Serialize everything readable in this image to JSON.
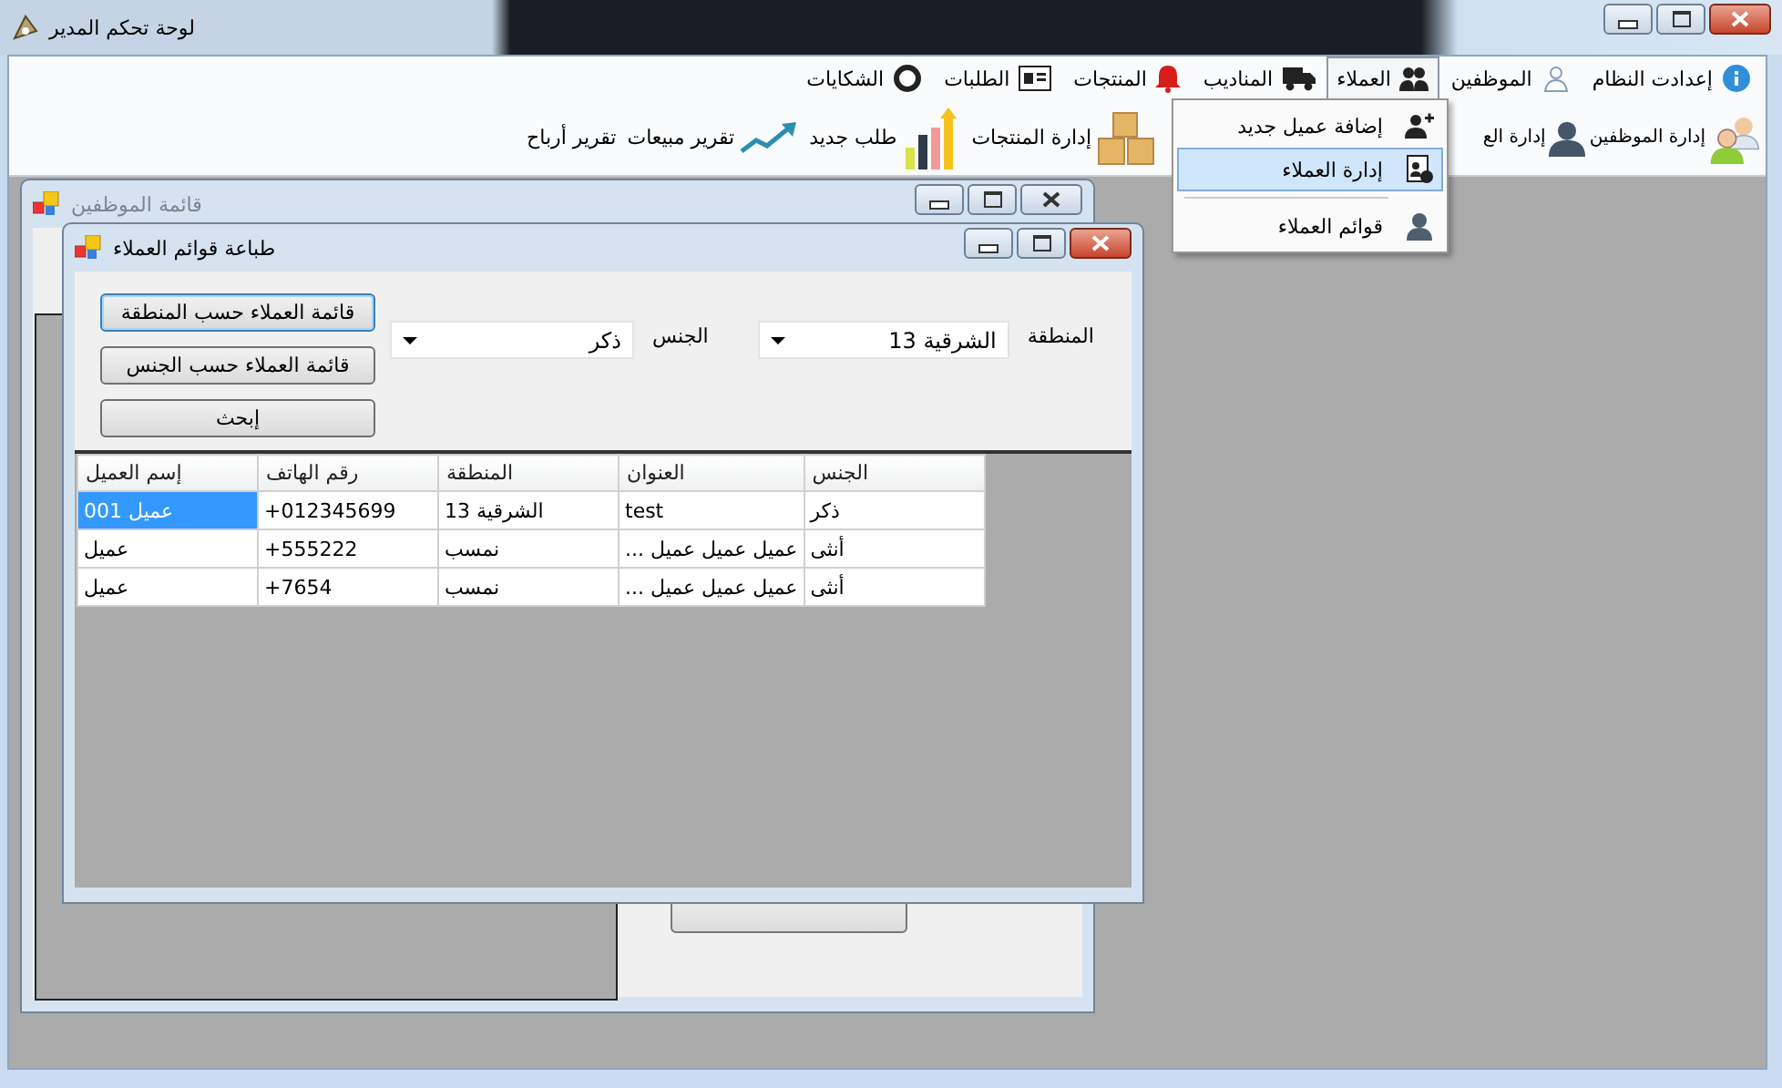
{
  "window": {
    "title": "لوحة تحكم المدير"
  },
  "menu": [
    {
      "label": "إعدادت النظام",
      "selected": false
    },
    {
      "label": "الموظفين",
      "selected": false
    },
    {
      "label": "العملاء",
      "selected": true
    },
    {
      "label": "المناديب",
      "selected": false
    },
    {
      "label": "المنتجات",
      "selected": false
    },
    {
      "label": "الطلبات",
      "selected": false
    },
    {
      "label": "الشكايات",
      "selected": false
    }
  ],
  "dropdown": [
    {
      "label": "إضافة عميل جديد",
      "selected": false
    },
    {
      "label": "إدارة العملاء",
      "selected": true
    },
    {
      "label": "قوائم العملاء",
      "selected": false
    }
  ],
  "toolbar": [
    {
      "label": "إدارة الموظفين"
    },
    {
      "label": "إدارة الع"
    },
    {
      "label": "إدارة المنتجات"
    },
    {
      "label": "طلب جديد"
    },
    {
      "label": "تقرير مبيعات"
    },
    {
      "label": "تقرير أرباح"
    }
  ],
  "employees_window": {
    "title": "قائمة الموظفين"
  },
  "dialog": {
    "title": "طباعة قوائم العملاء",
    "buttons": [
      {
        "label": "قائمة العملاء حسب المنطقة",
        "focused": true
      },
      {
        "label": "قائمة العملاء حسب الجنس",
        "focused": false
      },
      {
        "label": "إبحث",
        "focused": false
      }
    ],
    "gender_label": "الجنس",
    "gender_value": "ذكر",
    "region_label": "المنطقة",
    "region_value": "الشرقية 13",
    "table": {
      "columns": [
        "الجنس",
        "العنوان",
        "المنطقة",
        "رقم الهاتف",
        "إسم العميل"
      ],
      "rows": [
        {
          "cells": [
            {
              "text": "ذكر",
              "selected": false
            },
            {
              "text": "test",
              "selected": false
            },
            {
              "text": "الشرقية 13",
              "selected": false
            },
            {
              "text": "+012345699",
              "selected": false
            },
            {
              "text": "عميل 001",
              "selected": true
            }
          ]
        },
        {
          "cells": [
            {
              "text": "أنثى",
              "selected": false
            },
            {
              "text": "عميل عميل عميل ...",
              "selected": false
            },
            {
              "text": "نمسب",
              "selected": false
            },
            {
              "text": "+555222",
              "selected": false
            },
            {
              "text": "عميل",
              "selected": false
            }
          ]
        },
        {
          "cells": [
            {
              "text": "أنثى",
              "selected": false
            },
            {
              "text": "عميل عميل عميل ...",
              "selected": false
            },
            {
              "text": "نمسب",
              "selected": false
            },
            {
              "text": "+7654",
              "selected": false
            },
            {
              "text": "عميل",
              "selected": false
            }
          ]
        }
      ]
    }
  }
}
